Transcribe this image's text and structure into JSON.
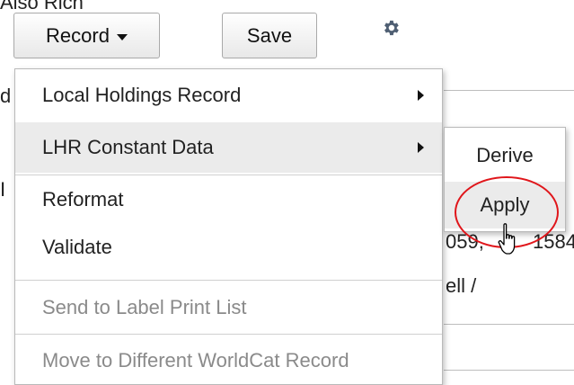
{
  "header": {
    "title": "Also Rich"
  },
  "toolbar": {
    "record_label": "Record",
    "save_label": "Save",
    "settings_icon": "gear-icon"
  },
  "background": {
    "fragment_1": "d",
    "fragment_2": "I",
    "fragment_3": "059,",
    "fragment_4": "1584",
    "fragment_5": "ell /"
  },
  "record_menu": {
    "items": [
      {
        "label": "Local Holdings Record",
        "has_submenu": true,
        "enabled": true
      },
      {
        "label": "LHR Constant Data",
        "has_submenu": true,
        "enabled": true,
        "active": true
      },
      {
        "label": "Reformat",
        "enabled": true
      },
      {
        "label": "Validate",
        "enabled": true
      },
      {
        "label": "Send to Label Print List",
        "enabled": false
      },
      {
        "label": "Move to Different WorldCat Record",
        "enabled": false
      }
    ]
  },
  "constant_data_submenu": {
    "items": [
      {
        "label": "Derive"
      },
      {
        "label": "Apply",
        "hovered": true
      }
    ]
  },
  "annotation": {
    "highlight_color": "#e0161b"
  }
}
